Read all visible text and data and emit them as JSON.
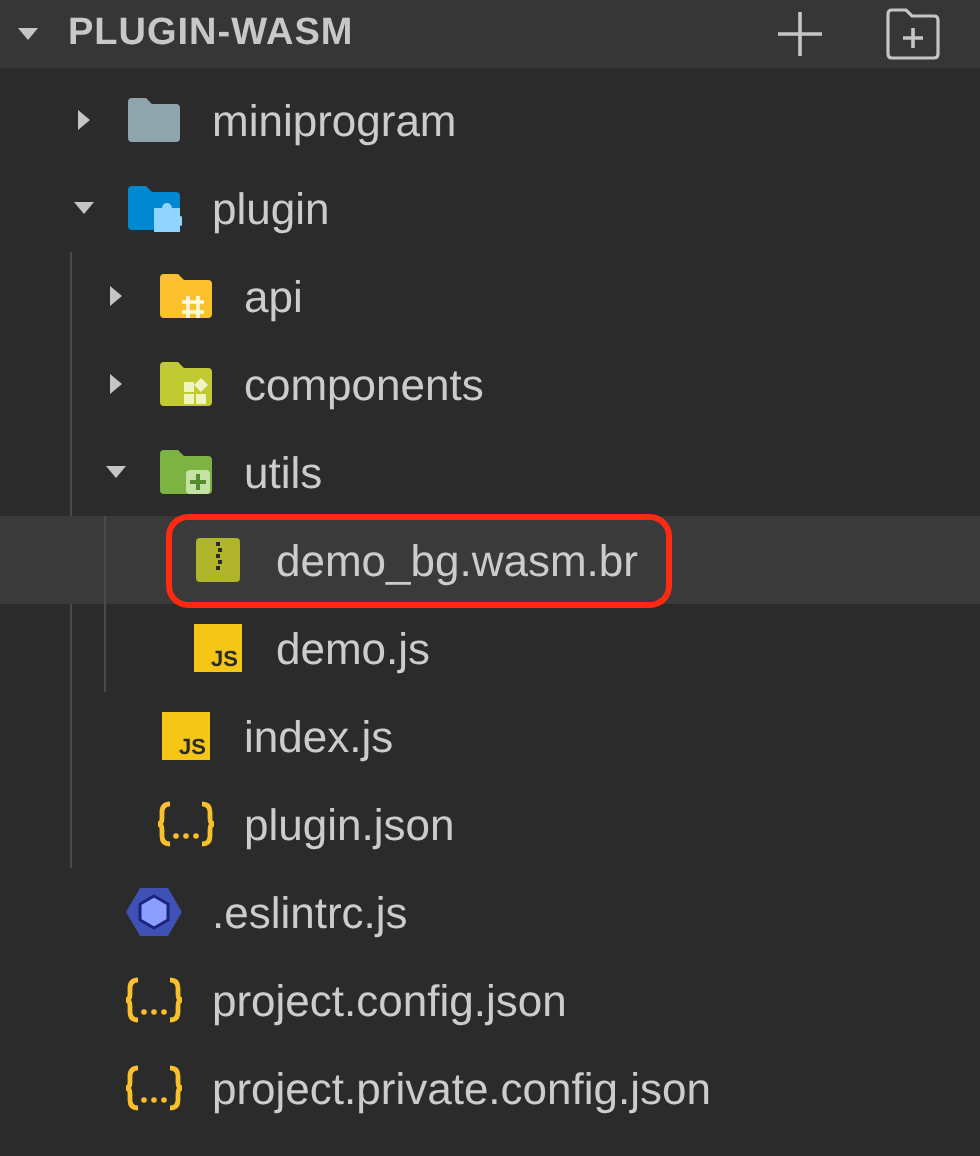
{
  "header": {
    "title": "PLUGIN-WASM",
    "expanded": true
  },
  "tree": [
    {
      "name": "miniprogram",
      "kind": "folder",
      "expanded": false,
      "selected": false
    },
    {
      "name": "plugin",
      "kind": "folder-plugin",
      "expanded": true,
      "selected": false,
      "children": [
        {
          "name": "api",
          "kind": "folder-api",
          "expanded": false,
          "selected": false
        },
        {
          "name": "components",
          "kind": "folder-components",
          "expanded": false,
          "selected": false
        },
        {
          "name": "utils",
          "kind": "folder-utils",
          "expanded": true,
          "selected": false,
          "children": [
            {
              "name": "demo_bg.wasm.br",
              "kind": "wasm",
              "selected": true,
              "highlighted": true
            },
            {
              "name": "demo.js",
              "kind": "js",
              "badge": "JS",
              "selected": false
            }
          ]
        },
        {
          "name": "index.js",
          "kind": "js",
          "badge": "JS",
          "selected": false
        },
        {
          "name": "plugin.json",
          "kind": "json",
          "selected": false
        }
      ]
    },
    {
      "name": ".eslintrc.js",
      "kind": "eslint",
      "selected": false
    },
    {
      "name": "project.config.json",
      "kind": "json",
      "selected": false
    },
    {
      "name": "project.private.config.json",
      "kind": "json",
      "selected": false
    }
  ]
}
